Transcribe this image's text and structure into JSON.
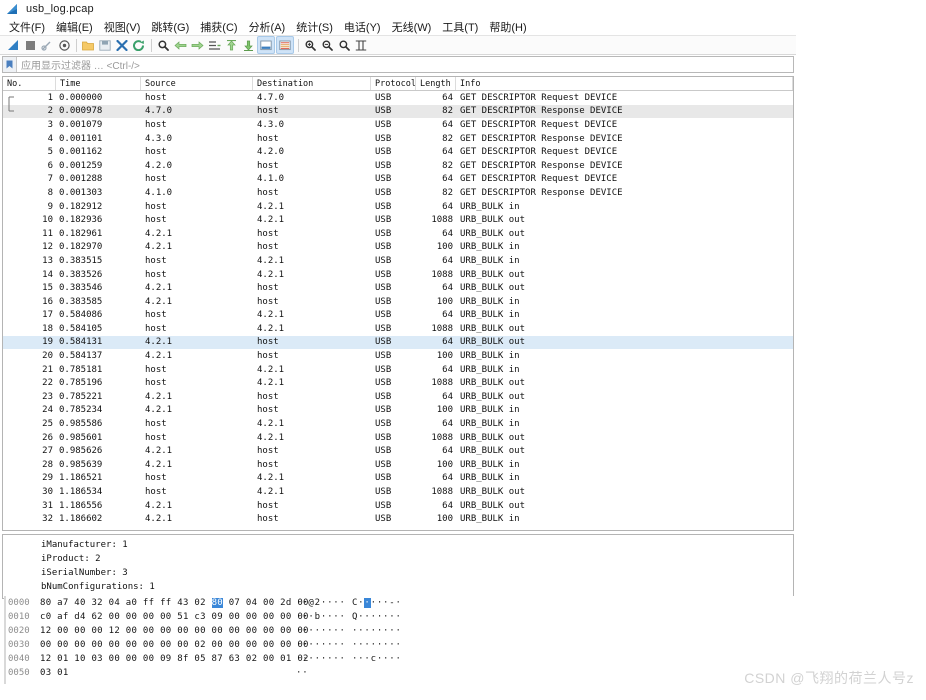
{
  "window": {
    "title": "usb_log.pcap",
    "app_icon": "wireshark-shark-fin-icon"
  },
  "menu": {
    "items": [
      {
        "label": "文件(F)",
        "name": "file"
      },
      {
        "label": "编辑(E)",
        "name": "edit"
      },
      {
        "label": "视图(V)",
        "name": "view"
      },
      {
        "label": "跳转(G)",
        "name": "go"
      },
      {
        "label": "捕获(C)",
        "name": "capture"
      },
      {
        "label": "分析(A)",
        "name": "analyze"
      },
      {
        "label": "统计(S)",
        "name": "statistics"
      },
      {
        "label": "电话(Y)",
        "name": "telephony"
      },
      {
        "label": "无线(W)",
        "name": "wireless"
      },
      {
        "label": "工具(T)",
        "name": "tools"
      },
      {
        "label": "帮助(H)",
        "name": "help"
      }
    ]
  },
  "toolbar": {
    "buttons": [
      {
        "name": "start-capture-icon",
        "glyph": "shark"
      },
      {
        "name": "stop-capture-icon",
        "glyph": "stop"
      },
      {
        "name": "restart-capture-icon",
        "glyph": "restart"
      },
      {
        "name": "capture-options-icon",
        "glyph": "options"
      },
      {
        "name": "open-file-icon",
        "glyph": "folder"
      },
      {
        "name": "save-file-icon",
        "glyph": "save"
      },
      {
        "name": "close-file-icon",
        "glyph": "close"
      },
      {
        "name": "reload-file-icon",
        "glyph": "reload"
      },
      {
        "name": "find-packet-icon",
        "glyph": "magnifier"
      },
      {
        "name": "go-back-icon",
        "glyph": "arrow-left"
      },
      {
        "name": "go-forward-icon",
        "glyph": "arrow-right"
      },
      {
        "name": "go-to-packet-icon",
        "glyph": "goto"
      },
      {
        "name": "go-first-packet-icon",
        "glyph": "first"
      },
      {
        "name": "go-last-packet-icon",
        "glyph": "last"
      },
      {
        "name": "autoscroll-icon",
        "glyph": "autoscroll"
      },
      {
        "name": "colorize-icon",
        "glyph": "colorize"
      },
      {
        "name": "zoom-in-icon",
        "glyph": "zoom-in"
      },
      {
        "name": "zoom-out-icon",
        "glyph": "zoom-out"
      },
      {
        "name": "zoom-reset-icon",
        "glyph": "zoom-reset"
      },
      {
        "name": "resize-columns-icon",
        "glyph": "resize"
      }
    ]
  },
  "filter": {
    "placeholder": "应用显示过滤器 … <Ctrl-/>",
    "value": "",
    "bookmark_icon": "filter-bookmark-icon"
  },
  "packet_list": {
    "columns": [
      "No.",
      "Time",
      "Source",
      "Destination",
      "Protocol",
      "Length",
      "Info"
    ],
    "selected_no": 19,
    "rows": [
      {
        "no": "1",
        "time": "0.000000",
        "src": "host",
        "dst": "4.7.0",
        "proto": "USB",
        "len": "64",
        "info": "GET DESCRIPTOR Request DEVICE"
      },
      {
        "no": "2",
        "time": "0.000978",
        "src": "4.7.0",
        "dst": "host",
        "proto": "USB",
        "len": "82",
        "info": "GET DESCRIPTOR Response DEVICE"
      },
      {
        "no": "3",
        "time": "0.001079",
        "src": "host",
        "dst": "4.3.0",
        "proto": "USB",
        "len": "64",
        "info": "GET DESCRIPTOR Request DEVICE"
      },
      {
        "no": "4",
        "time": "0.001101",
        "src": "4.3.0",
        "dst": "host",
        "proto": "USB",
        "len": "82",
        "info": "GET DESCRIPTOR Response DEVICE"
      },
      {
        "no": "5",
        "time": "0.001162",
        "src": "host",
        "dst": "4.2.0",
        "proto": "USB",
        "len": "64",
        "info": "GET DESCRIPTOR Request DEVICE"
      },
      {
        "no": "6",
        "time": "0.001259",
        "src": "4.2.0",
        "dst": "host",
        "proto": "USB",
        "len": "82",
        "info": "GET DESCRIPTOR Response DEVICE"
      },
      {
        "no": "7",
        "time": "0.001288",
        "src": "host",
        "dst": "4.1.0",
        "proto": "USB",
        "len": "64",
        "info": "GET DESCRIPTOR Request DEVICE"
      },
      {
        "no": "8",
        "time": "0.001303",
        "src": "4.1.0",
        "dst": "host",
        "proto": "USB",
        "len": "82",
        "info": "GET DESCRIPTOR Response DEVICE"
      },
      {
        "no": "9",
        "time": "0.182912",
        "src": "host",
        "dst": "4.2.1",
        "proto": "USB",
        "len": "64",
        "info": "URB_BULK in"
      },
      {
        "no": "10",
        "time": "0.182936",
        "src": "host",
        "dst": "4.2.1",
        "proto": "USB",
        "len": "1088",
        "info": "URB_BULK out"
      },
      {
        "no": "11",
        "time": "0.182961",
        "src": "4.2.1",
        "dst": "host",
        "proto": "USB",
        "len": "64",
        "info": "URB_BULK out"
      },
      {
        "no": "12",
        "time": "0.182970",
        "src": "4.2.1",
        "dst": "host",
        "proto": "USB",
        "len": "100",
        "info": "URB_BULK in"
      },
      {
        "no": "13",
        "time": "0.383515",
        "src": "host",
        "dst": "4.2.1",
        "proto": "USB",
        "len": "64",
        "info": "URB_BULK in"
      },
      {
        "no": "14",
        "time": "0.383526",
        "src": "host",
        "dst": "4.2.1",
        "proto": "USB",
        "len": "1088",
        "info": "URB_BULK out"
      },
      {
        "no": "15",
        "time": "0.383546",
        "src": "4.2.1",
        "dst": "host",
        "proto": "USB",
        "len": "64",
        "info": "URB_BULK out"
      },
      {
        "no": "16",
        "time": "0.383585",
        "src": "4.2.1",
        "dst": "host",
        "proto": "USB",
        "len": "100",
        "info": "URB_BULK in"
      },
      {
        "no": "17",
        "time": "0.584086",
        "src": "host",
        "dst": "4.2.1",
        "proto": "USB",
        "len": "64",
        "info": "URB_BULK in"
      },
      {
        "no": "18",
        "time": "0.584105",
        "src": "host",
        "dst": "4.2.1",
        "proto": "USB",
        "len": "1088",
        "info": "URB_BULK out"
      },
      {
        "no": "19",
        "time": "0.584131",
        "src": "4.2.1",
        "dst": "host",
        "proto": "USB",
        "len": "64",
        "info": "URB_BULK out"
      },
      {
        "no": "20",
        "time": "0.584137",
        "src": "4.2.1",
        "dst": "host",
        "proto": "USB",
        "len": "100",
        "info": "URB_BULK in"
      },
      {
        "no": "21",
        "time": "0.785181",
        "src": "host",
        "dst": "4.2.1",
        "proto": "USB",
        "len": "64",
        "info": "URB_BULK in"
      },
      {
        "no": "22",
        "time": "0.785196",
        "src": "host",
        "dst": "4.2.1",
        "proto": "USB",
        "len": "1088",
        "info": "URB_BULK out"
      },
      {
        "no": "23",
        "time": "0.785221",
        "src": "4.2.1",
        "dst": "host",
        "proto": "USB",
        "len": "64",
        "info": "URB_BULK out"
      },
      {
        "no": "24",
        "time": "0.785234",
        "src": "4.2.1",
        "dst": "host",
        "proto": "USB",
        "len": "100",
        "info": "URB_BULK in"
      },
      {
        "no": "25",
        "time": "0.985586",
        "src": "host",
        "dst": "4.2.1",
        "proto": "USB",
        "len": "64",
        "info": "URB_BULK in"
      },
      {
        "no": "26",
        "time": "0.985601",
        "src": "host",
        "dst": "4.2.1",
        "proto": "USB",
        "len": "1088",
        "info": "URB_BULK out"
      },
      {
        "no": "27",
        "time": "0.985626",
        "src": "4.2.1",
        "dst": "host",
        "proto": "USB",
        "len": "64",
        "info": "URB_BULK out"
      },
      {
        "no": "28",
        "time": "0.985639",
        "src": "4.2.1",
        "dst": "host",
        "proto": "USB",
        "len": "100",
        "info": "URB_BULK in"
      },
      {
        "no": "29",
        "time": "1.186521",
        "src": "host",
        "dst": "4.2.1",
        "proto": "USB",
        "len": "64",
        "info": "URB_BULK in"
      },
      {
        "no": "30",
        "time": "1.186534",
        "src": "host",
        "dst": "4.2.1",
        "proto": "USB",
        "len": "1088",
        "info": "URB_BULK out"
      },
      {
        "no": "31",
        "time": "1.186556",
        "src": "4.2.1",
        "dst": "host",
        "proto": "USB",
        "len": "64",
        "info": "URB_BULK out"
      },
      {
        "no": "32",
        "time": "1.186602",
        "src": "4.2.1",
        "dst": "host",
        "proto": "USB",
        "len": "100",
        "info": "URB_BULK in"
      }
    ]
  },
  "detail_pane": {
    "lines": [
      "iManufacturer: 1",
      "iProduct: 2",
      "iSerialNumber: 3",
      "bNumConfigurations: 1"
    ]
  },
  "hex_pane": {
    "highlight_color": "#3a87d8",
    "rows": [
      {
        "offset": "0000",
        "bytes_pre": "80 a7 40 32 04 a0 ff ff  43 02 ",
        "bytes_hl": "80",
        "bytes_post": " 07 04 00 2d 00",
        "ascii_pre": "··@2···· C·",
        "ascii_hl": "·",
        "ascii_post": "···-·"
      },
      {
        "offset": "0010",
        "bytes_pre": "c0 af d4 62 00 00 00 00  51 c3 09 00 00 00 00 00",
        "bytes_hl": "",
        "bytes_post": "",
        "ascii_pre": "···b···· Q·······",
        "ascii_hl": "",
        "ascii_post": ""
      },
      {
        "offset": "0020",
        "bytes_pre": "12 00 00 00 12 00 00 00  00 00 00 00 00 00 00 00",
        "bytes_hl": "",
        "bytes_post": "",
        "ascii_pre": "········ ········",
        "ascii_hl": "",
        "ascii_post": ""
      },
      {
        "offset": "0030",
        "bytes_pre": "00 00 00 00 00 00 00 00  00 02 00 00 00 00 00 00",
        "bytes_hl": "",
        "bytes_post": "",
        "ascii_pre": "········ ········",
        "ascii_hl": "",
        "ascii_post": ""
      },
      {
        "offset": "0040",
        "bytes_pre": "12 01 10 03 00 00 00 09  8f 05 87 63 02 00 01 02",
        "bytes_hl": "",
        "bytes_post": "",
        "ascii_pre": "········ ···c····",
        "ascii_hl": "",
        "ascii_post": ""
      },
      {
        "offset": "0050",
        "bytes_pre": "03 01",
        "bytes_hl": "",
        "bytes_post": "",
        "ascii_pre": "··",
        "ascii_hl": "",
        "ascii_post": ""
      }
    ]
  },
  "watermark": {
    "text": "CSDN @飞翔的荷兰人号z"
  }
}
